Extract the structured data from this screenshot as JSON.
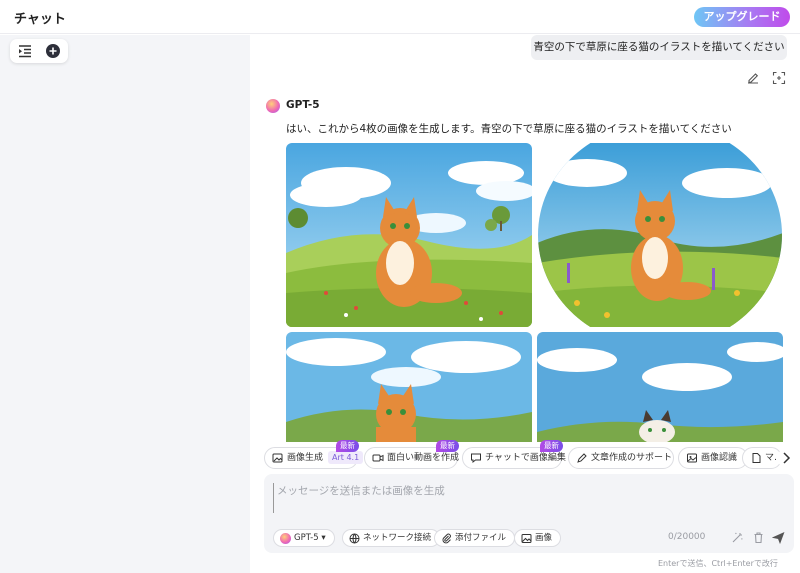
{
  "header": {
    "title": "チャット",
    "upgrade_label": "アップグレード"
  },
  "sidebar": {
    "toggle_icon": "list-indent-icon",
    "new_chat_icon": "plus-circle-icon"
  },
  "conversation": {
    "user_message": "青空の下で草原に座る猫のイラストを描いてください",
    "assistant_name": "GPT-5",
    "assistant_text": "はい、これから4枚の画像を生成します。青空の下で草原に座る猫のイラストを描いてください"
  },
  "suggestions": [
    {
      "label": "画像生成",
      "tag": "Art 4.1",
      "badge": "最新",
      "icon": "image-plus-icon"
    },
    {
      "label": "面白い動画を作成",
      "tag": "",
      "badge": "最新",
      "icon": "video-icon"
    },
    {
      "label": "チャットで画像編集",
      "tag": "",
      "badge": "最新",
      "icon": "chat-image-icon"
    },
    {
      "label": "文章作成のサポート",
      "tag": "",
      "badge": "",
      "icon": "pen-icon"
    },
    {
      "label": "画像認識",
      "tag": "",
      "badge": "",
      "icon": "image-scan-icon"
    },
    {
      "label": "マ…",
      "tag": "",
      "badge": "",
      "icon": "doc-icon"
    }
  ],
  "input": {
    "placeholder": "メッセージを送信または画像を生成",
    "value": "",
    "model_label": "GPT-5",
    "network_label": "ネットワーク接続",
    "attach_label": "添付ファイル",
    "image_label": "画像",
    "counter": "0/20000",
    "hint": "Enterで送信、Ctrl+Enterで改行"
  },
  "colors": {
    "accent_purple": "#a977f2",
    "accent_blue": "#6ec6f5",
    "badge": "#b34ae6",
    "sky": "#7cc3ec",
    "grass": "#9cc548",
    "cat": "#e58b3a"
  }
}
